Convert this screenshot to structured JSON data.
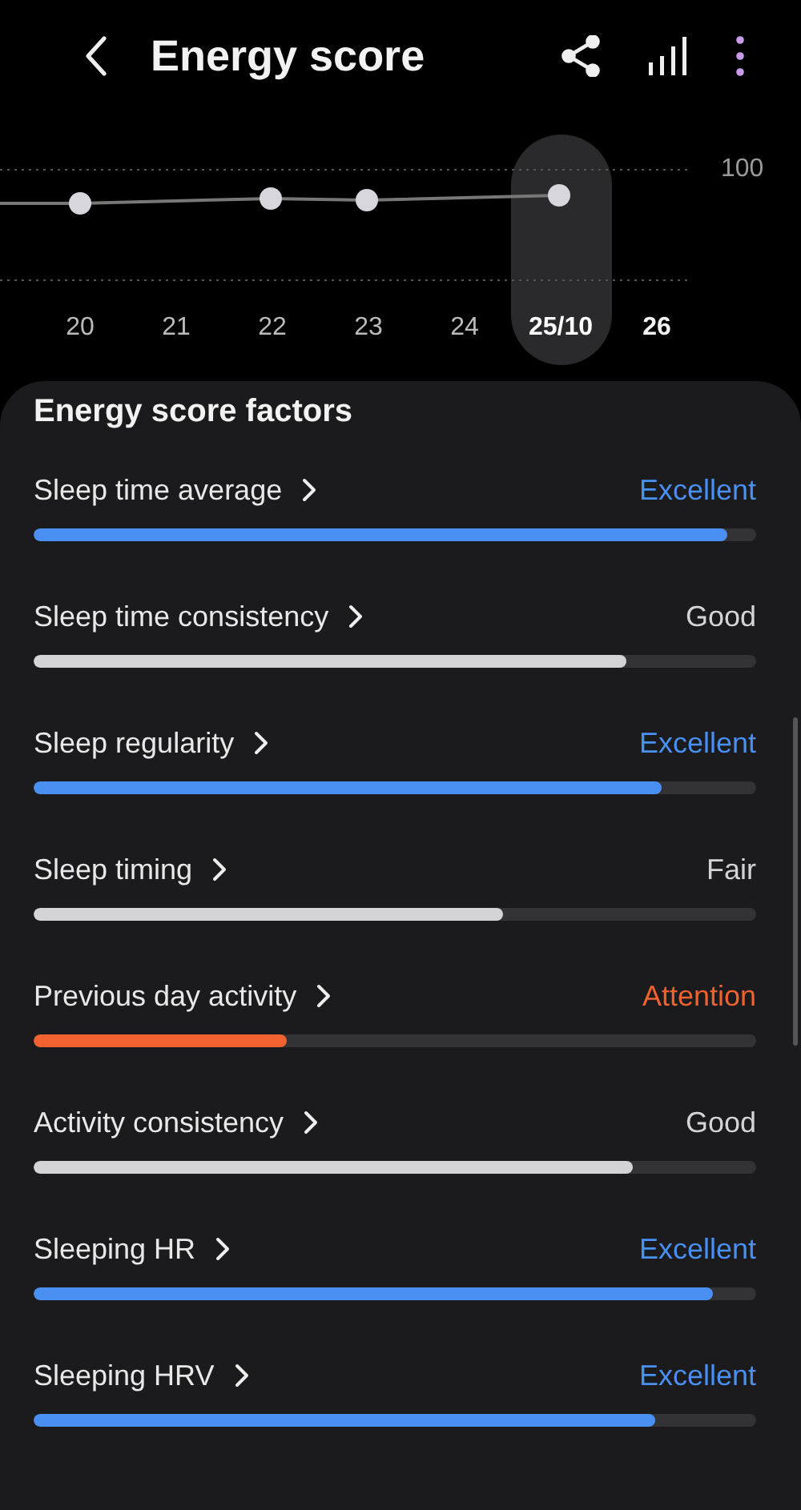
{
  "header": {
    "title": "Energy score"
  },
  "chart": {
    "max_label": "100",
    "dates": [
      {
        "label": "20",
        "selected": false,
        "highlighted": false
      },
      {
        "label": "21",
        "selected": false,
        "highlighted": false
      },
      {
        "label": "22",
        "selected": false,
        "highlighted": false
      },
      {
        "label": "23",
        "selected": false,
        "highlighted": false
      },
      {
        "label": "24",
        "selected": false,
        "highlighted": false
      },
      {
        "label": "25/10",
        "selected": true,
        "highlighted": true
      },
      {
        "label": "26",
        "selected": false,
        "highlighted": true
      }
    ]
  },
  "factors_card": {
    "title": "Energy score factors",
    "factors": [
      {
        "name": "Sleep time average",
        "status": "Excellent",
        "color": "#4a90f2",
        "level": 0.96
      },
      {
        "name": "Sleep time consistency",
        "status": "Good",
        "color": "#d4d4d8",
        "level": 0.82
      },
      {
        "name": "Sleep regularity",
        "status": "Excellent",
        "color": "#4a90f2",
        "level": 0.87
      },
      {
        "name": "Sleep timing",
        "status": "Fair",
        "color": "#d4d4d8",
        "level": 0.65
      },
      {
        "name": "Previous day activity",
        "status": "Attention",
        "color": "#f0622f",
        "level": 0.35
      },
      {
        "name": "Activity consistency",
        "status": "Good",
        "color": "#d4d4d8",
        "level": 0.83
      },
      {
        "name": "Sleeping HR",
        "status": "Excellent",
        "color": "#4a90f2",
        "level": 0.94
      },
      {
        "name": "Sleeping HRV",
        "status": "Excellent",
        "color": "#4a90f2",
        "level": 0.86
      }
    ]
  }
}
